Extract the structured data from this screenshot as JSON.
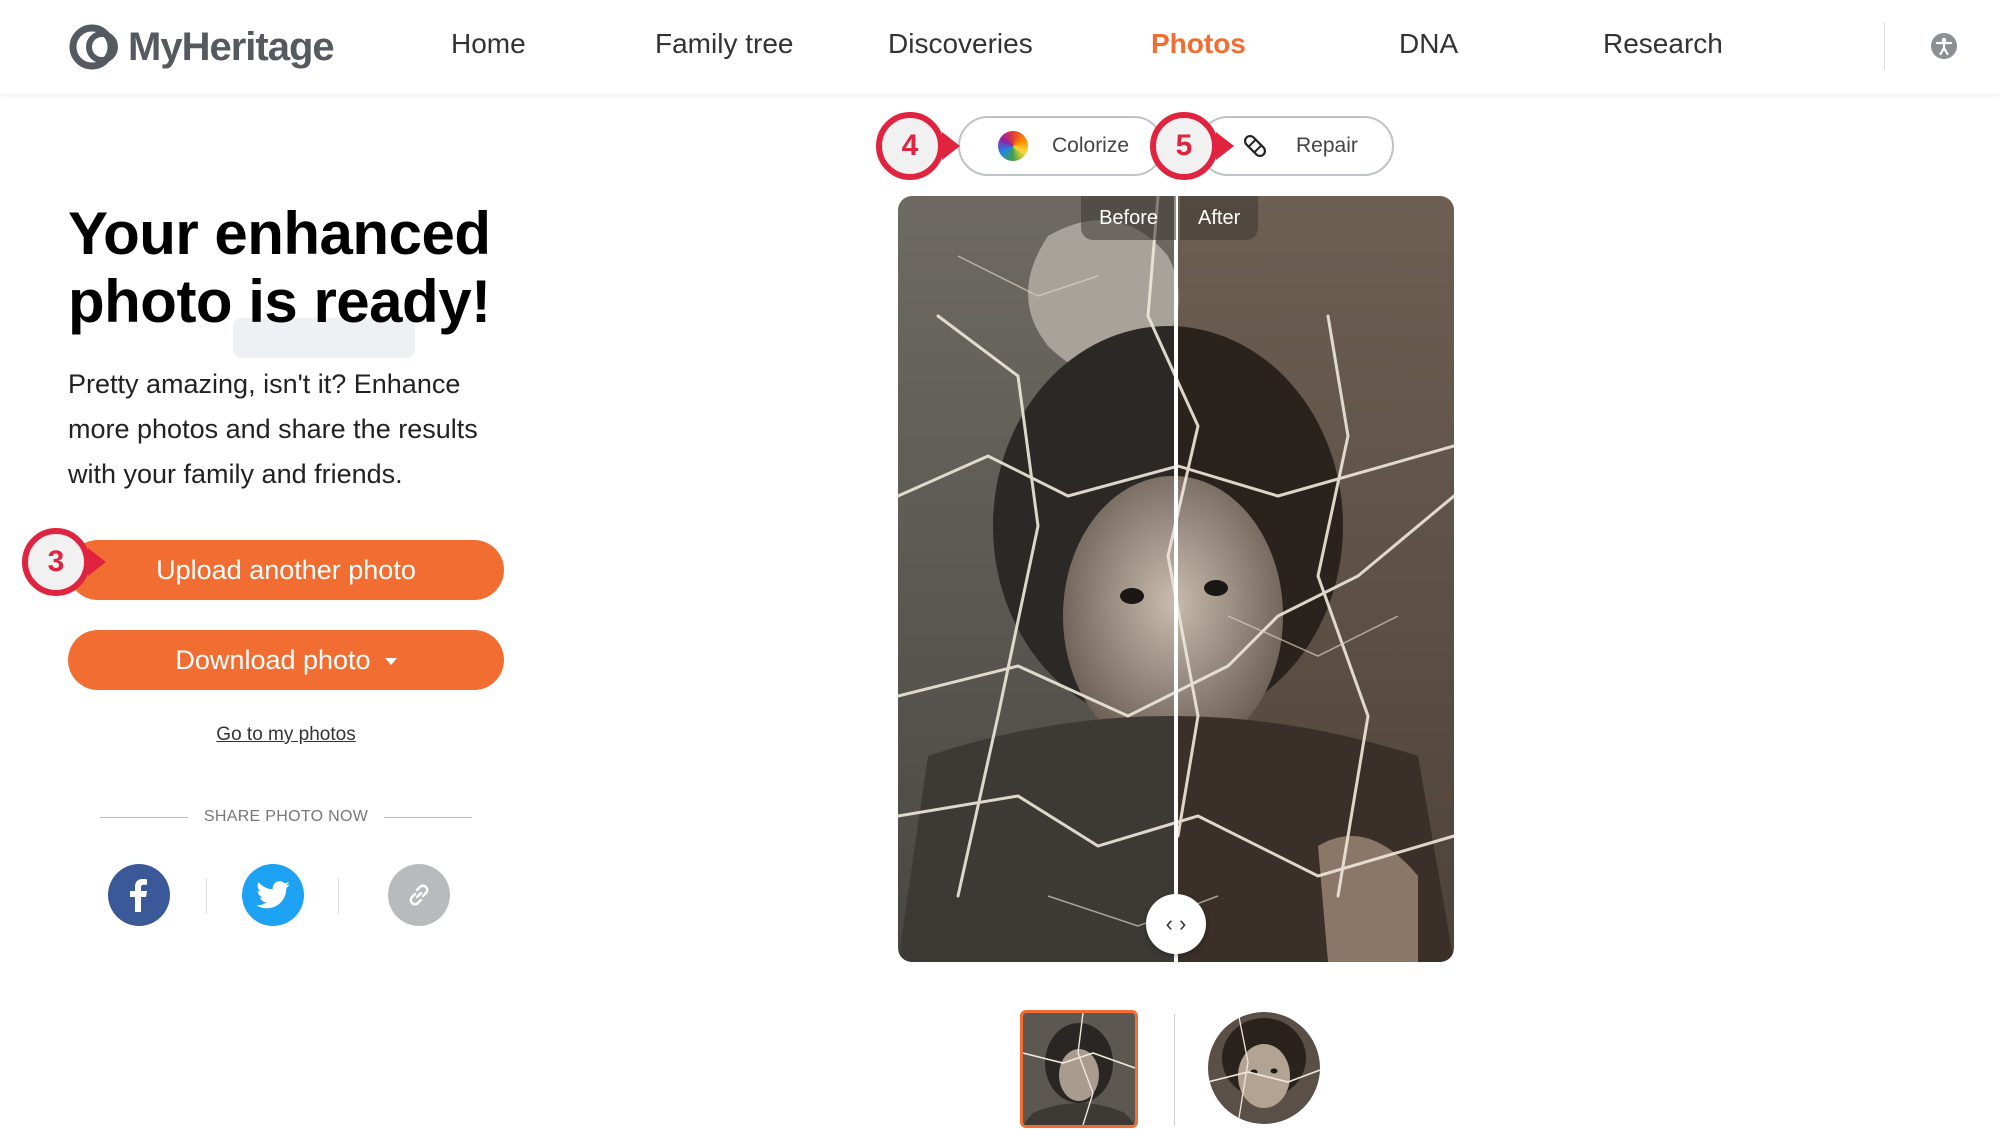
{
  "brand": {
    "name": "MyHeritage"
  },
  "nav": {
    "items": [
      {
        "label": "Home"
      },
      {
        "label": "Family tree"
      },
      {
        "label": "Discoveries"
      },
      {
        "label": "Photos"
      },
      {
        "label": "DNA"
      },
      {
        "label": "Research"
      }
    ],
    "active": "Photos",
    "accessibility_icon": "accessibility-icon"
  },
  "main": {
    "headline": "Your enhanced photo is ready!",
    "subtext": "Pretty amazing, isn't it? Enhance more photos and share the results with your family and friends.",
    "upload_button": "Upload another photo",
    "download_button": "Download photo",
    "goto_link": "Go to my photos",
    "share_label": "SHARE PHOTO NOW",
    "share_icons": [
      "facebook-icon",
      "twitter-icon",
      "link-icon"
    ]
  },
  "tools": {
    "colorize_label": "Colorize",
    "repair_label": "Repair",
    "colorize_icon": "color-wheel-icon",
    "repair_icon": "bandage-icon"
  },
  "comparison": {
    "before_label": "Before",
    "after_label": "After",
    "handle_glyph": "‹ ›"
  },
  "callouts": [
    "3",
    "4",
    "5"
  ],
  "colors": {
    "accent": "#f26d31",
    "callout": "#e0243f",
    "facebook": "#3b5998",
    "twitter": "#1da1f2",
    "link": "#b8babc"
  }
}
